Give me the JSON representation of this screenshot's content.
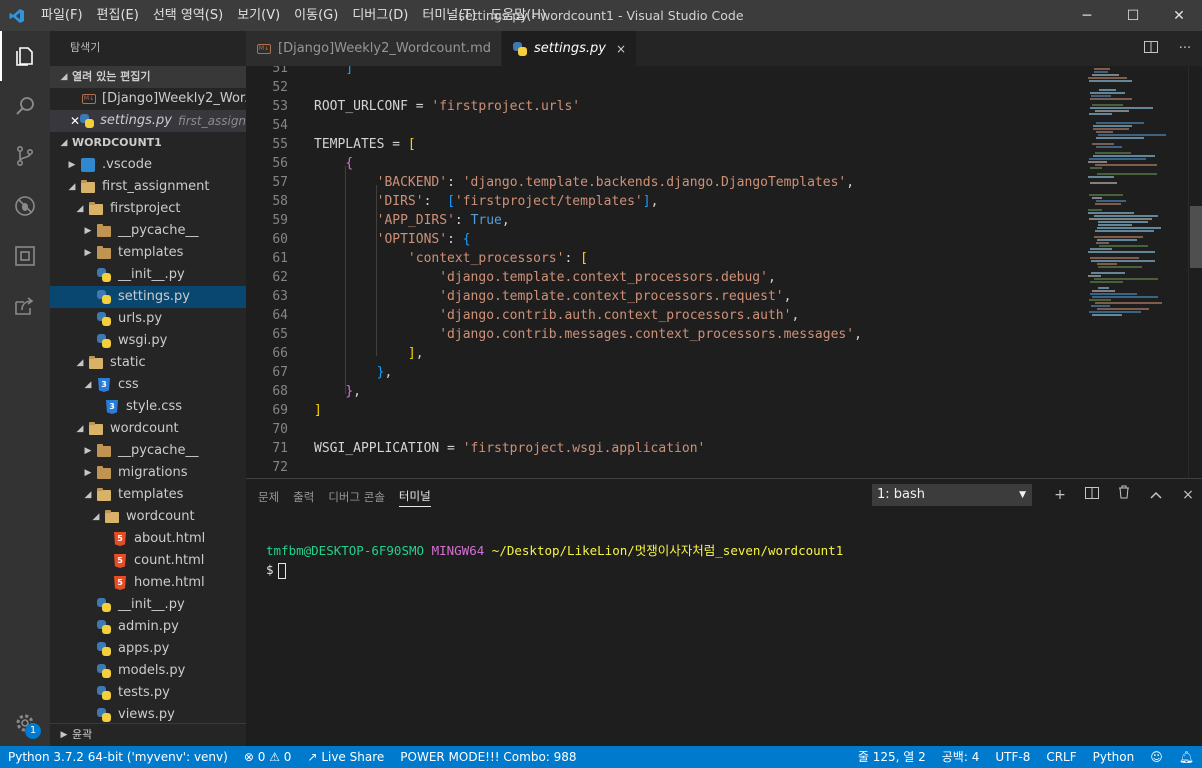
{
  "window": {
    "title": "settings.py - wordcount1 - Visual Studio Code",
    "menu": [
      "파일(F)",
      "편집(E)",
      "선택 영역(S)",
      "보기(V)",
      "이동(G)",
      "디버그(D)",
      "터미널(T)",
      "도움말(H)"
    ],
    "controls": {
      "minimize": "─",
      "maximize": "☐",
      "close": "✕"
    }
  },
  "activity_bar": {
    "items": [
      "explorer",
      "search",
      "source-control",
      "debug",
      "extensions",
      "live-share"
    ],
    "settings_badge": "1"
  },
  "sidebar": {
    "title": "탐색기",
    "open_editors": {
      "header": "열려 있는 편집기",
      "items": [
        {
          "name": "[Django]Weekly2_Wor...",
          "icon": "markdown",
          "desc": ""
        },
        {
          "name": "settings.py",
          "icon": "python",
          "desc": "first_assignm..."
        }
      ]
    },
    "project": {
      "header": "WORDCOUNT1",
      "tree": [
        {
          "name": ".vscode",
          "type": "folder",
          "depth": 0,
          "expanded": false
        },
        {
          "name": "first_assignment",
          "type": "folder",
          "depth": 0,
          "expanded": true
        },
        {
          "name": "firstproject",
          "type": "folder",
          "depth": 1,
          "expanded": true
        },
        {
          "name": "__pycache__",
          "type": "folder",
          "depth": 2,
          "expanded": false
        },
        {
          "name": "templates",
          "type": "folder",
          "depth": 2,
          "expanded": false
        },
        {
          "name": "__init__.py",
          "type": "python",
          "depth": 2
        },
        {
          "name": "settings.py",
          "type": "python",
          "depth": 2,
          "selected": true
        },
        {
          "name": "urls.py",
          "type": "python",
          "depth": 2
        },
        {
          "name": "wsgi.py",
          "type": "python",
          "depth": 2
        },
        {
          "name": "static",
          "type": "folder",
          "depth": 1,
          "expanded": true
        },
        {
          "name": "css",
          "type": "folder-css",
          "depth": 2,
          "expanded": true
        },
        {
          "name": "style.css",
          "type": "css",
          "depth": 3
        },
        {
          "name": "wordcount",
          "type": "folder",
          "depth": 1,
          "expanded": true
        },
        {
          "name": "__pycache__",
          "type": "folder",
          "depth": 2,
          "expanded": false
        },
        {
          "name": "migrations",
          "type": "folder",
          "depth": 2,
          "expanded": false
        },
        {
          "name": "templates",
          "type": "folder",
          "depth": 2,
          "expanded": true
        },
        {
          "name": "wordcount",
          "type": "folder",
          "depth": 3,
          "expanded": true
        },
        {
          "name": "about.html",
          "type": "html",
          "depth": 4
        },
        {
          "name": "count.html",
          "type": "html",
          "depth": 4
        },
        {
          "name": "home.html",
          "type": "html",
          "depth": 4
        },
        {
          "name": "__init__.py",
          "type": "python",
          "depth": 2
        },
        {
          "name": "admin.py",
          "type": "python",
          "depth": 2
        },
        {
          "name": "apps.py",
          "type": "python",
          "depth": 2
        },
        {
          "name": "models.py",
          "type": "python",
          "depth": 2
        },
        {
          "name": "tests.py",
          "type": "python",
          "depth": 2
        },
        {
          "name": "views.py",
          "type": "python",
          "depth": 2
        }
      ]
    },
    "outline_header": "윤곽"
  },
  "tabs": [
    {
      "label": "[Django]Weekly2_Wordcount.md",
      "icon": "markdown",
      "active": false
    },
    {
      "label": "settings.py",
      "icon": "python",
      "active": true,
      "close": "×"
    }
  ],
  "editor": {
    "lines": [
      {
        "n": "51",
        "tokens": [
          [
            "    ",
            "id"
          ],
          [
            "]",
            "br3"
          ]
        ]
      },
      {
        "n": "52",
        "tokens": []
      },
      {
        "n": "53",
        "tokens": [
          [
            "ROOT_URLCONF = ",
            "id"
          ],
          [
            "'firstproject.urls'",
            "str"
          ]
        ]
      },
      {
        "n": "54",
        "tokens": []
      },
      {
        "n": "55",
        "tokens": [
          [
            "TEMPLATES = ",
            "id"
          ],
          [
            "[",
            "br1"
          ]
        ]
      },
      {
        "n": "56",
        "tokens": [
          [
            "    ",
            "id"
          ],
          [
            "{",
            "br2"
          ]
        ]
      },
      {
        "n": "57",
        "tokens": [
          [
            "        ",
            "id"
          ],
          [
            "'BACKEND'",
            "str"
          ],
          [
            ": ",
            "id"
          ],
          [
            "'django.template.backends.django.DjangoTemplates'",
            "str"
          ],
          [
            ",",
            "id"
          ]
        ]
      },
      {
        "n": "58",
        "tokens": [
          [
            "        ",
            "id"
          ],
          [
            "'DIRS'",
            "str"
          ],
          [
            ":  ",
            "id"
          ],
          [
            "[",
            "br3"
          ],
          [
            "'firstproject/templates'",
            "str"
          ],
          [
            "]",
            "br3"
          ],
          [
            ",",
            "id"
          ]
        ]
      },
      {
        "n": "59",
        "tokens": [
          [
            "        ",
            "id"
          ],
          [
            "'APP_DIRS'",
            "str"
          ],
          [
            ": ",
            "id"
          ],
          [
            "True",
            "kw"
          ],
          [
            ",",
            "id"
          ]
        ]
      },
      {
        "n": "60",
        "tokens": [
          [
            "        ",
            "id"
          ],
          [
            "'OPTIONS'",
            "str"
          ],
          [
            ": ",
            "id"
          ],
          [
            "{",
            "br3"
          ]
        ]
      },
      {
        "n": "61",
        "tokens": [
          [
            "            ",
            "id"
          ],
          [
            "'context_processors'",
            "str"
          ],
          [
            ": ",
            "id"
          ],
          [
            "[",
            "br1"
          ]
        ]
      },
      {
        "n": "62",
        "tokens": [
          [
            "                ",
            "id"
          ],
          [
            "'django.template.context_processors.debug'",
            "str"
          ],
          [
            ",",
            "id"
          ]
        ]
      },
      {
        "n": "63",
        "tokens": [
          [
            "                ",
            "id"
          ],
          [
            "'django.template.context_processors.request'",
            "str"
          ],
          [
            ",",
            "id"
          ]
        ]
      },
      {
        "n": "64",
        "tokens": [
          [
            "                ",
            "id"
          ],
          [
            "'django.contrib.auth.context_processors.auth'",
            "str"
          ],
          [
            ",",
            "id"
          ]
        ]
      },
      {
        "n": "65",
        "tokens": [
          [
            "                ",
            "id"
          ],
          [
            "'django.contrib.messages.context_processors.messages'",
            "str"
          ],
          [
            ",",
            "id"
          ]
        ]
      },
      {
        "n": "66",
        "tokens": [
          [
            "            ",
            "id"
          ],
          [
            "]",
            "br1"
          ],
          [
            ",",
            "id"
          ]
        ]
      },
      {
        "n": "67",
        "tokens": [
          [
            "        ",
            "id"
          ],
          [
            "}",
            "br3"
          ],
          [
            ",",
            "id"
          ]
        ]
      },
      {
        "n": "68",
        "tokens": [
          [
            "    ",
            "id"
          ],
          [
            "}",
            "br2"
          ],
          [
            ",",
            "id"
          ]
        ]
      },
      {
        "n": "69",
        "tokens": [
          [
            "",
            "id"
          ],
          [
            "]",
            "br1"
          ]
        ]
      },
      {
        "n": "70",
        "tokens": []
      },
      {
        "n": "71",
        "tokens": [
          [
            "WSGI_APPLICATION = ",
            "id"
          ],
          [
            "'firstproject.wsgi.application'",
            "str"
          ]
        ]
      },
      {
        "n": "72",
        "tokens": []
      }
    ]
  },
  "panel": {
    "tabs": [
      "문제",
      "출력",
      "디버그 콘솔",
      "터미널"
    ],
    "active_tab": "터미널",
    "terminal_select": "1: bash",
    "actions": {
      "new": "+",
      "split": "split",
      "trash": "trash",
      "maximize": "^",
      "close": "×"
    },
    "prompt": {
      "user": "tmfbm@DESKTOP-6F90SMO",
      "env": "MINGW64",
      "path": "~/Desktop/LikeLion/멋쟁이사자처럼_seven/wordcount1",
      "symbol": "$"
    }
  },
  "status_bar": {
    "interpreter": "Python 3.7.2 64-bit ('myvenv': venv)",
    "errors": "0",
    "warnings": "0",
    "live_share": "Live Share",
    "power_mode": "POWER MODE!!! Combo: 988",
    "position": "줄 125, 열 2",
    "spaces": "공백: 4",
    "encoding": "UTF-8",
    "eol": "CRLF",
    "language": "Python"
  },
  "colors": {
    "status_bar": "#007acc",
    "sidebar_selection": "#094771",
    "string": "#ce9178",
    "keyword": "#569cd6"
  }
}
